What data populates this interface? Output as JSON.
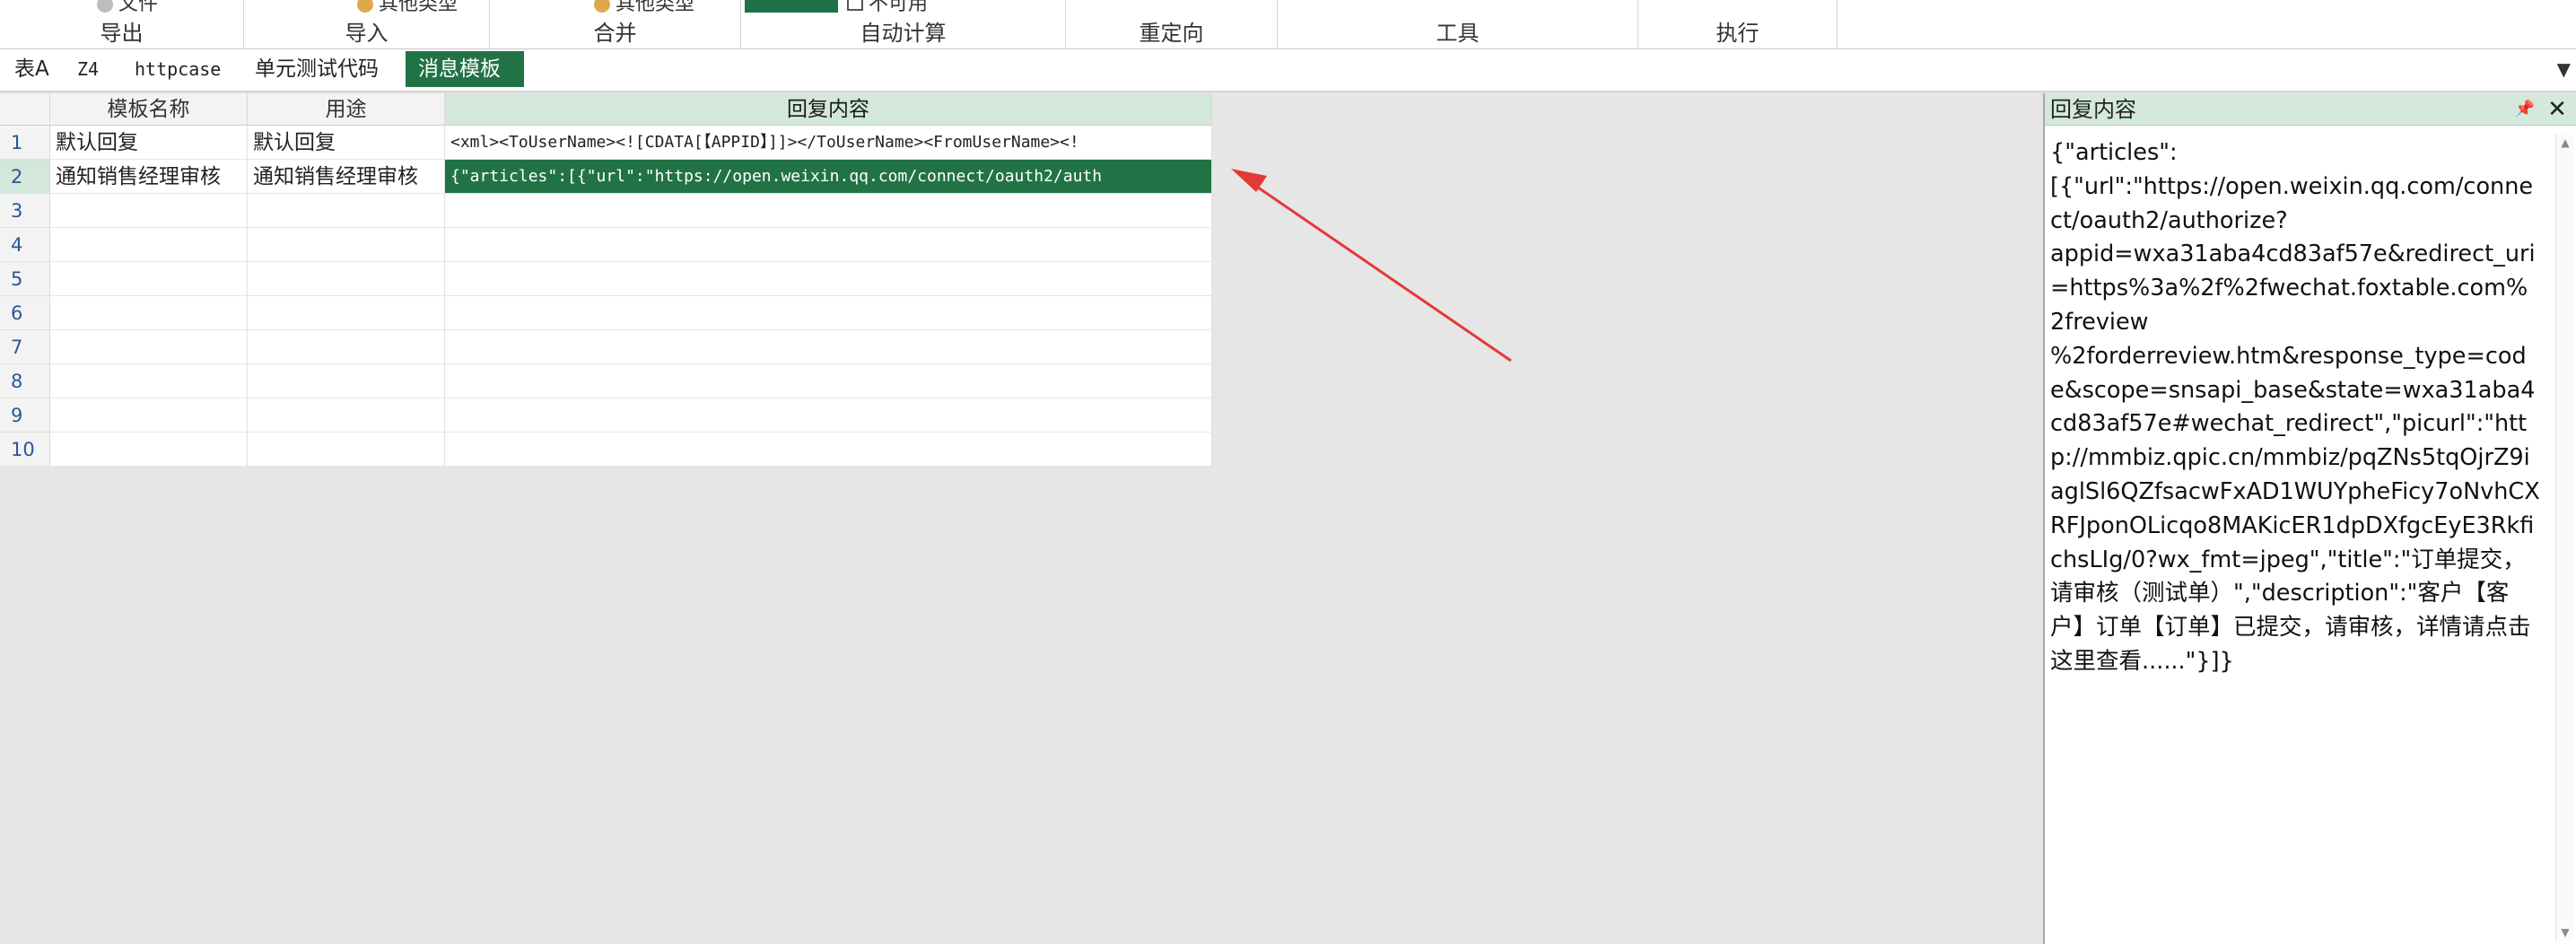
{
  "ribbon": {
    "peek": {
      "export_btn": "文件",
      "import_btn": "其他类型",
      "merge_btn": "其他类型",
      "calc_btn": "不可用"
    },
    "groups": [
      {
        "label": "导出"
      },
      {
        "label": "导入"
      },
      {
        "label": "合并"
      },
      {
        "label": "自动计算"
      },
      {
        "label": "重定向"
      },
      {
        "label": "工具"
      },
      {
        "label": "执行"
      }
    ]
  },
  "tabs": [
    {
      "label": "表A"
    },
    {
      "label": "Z4"
    },
    {
      "label": "httpcase"
    },
    {
      "label": "单元测试代码"
    },
    {
      "label": "消息模板"
    }
  ],
  "tabs_dropdown_icon": "chevron-down-icon",
  "grid": {
    "columns": [
      "模板名称",
      "用途",
      "回复内容"
    ],
    "row_numbers": [
      "1",
      "2",
      "3",
      "4",
      "5",
      "6",
      "7",
      "8",
      "9",
      "10"
    ],
    "rows": [
      [
        "默认回复",
        "默认回复",
        "<xml><ToUserName><![CDATA[【APPID】]]></ToUserName><FromUserName><!"
      ],
      [
        "通知销售经理审核",
        "通知销售经理审核",
        "{\"articles\":[{\"url\":\"https://open.weixin.qq.com/connect/oauth2/auth"
      ]
    ],
    "selected_row": 2,
    "selected_column": 3
  },
  "panel": {
    "title": "回复内容",
    "pin_icon": "📌",
    "close_icon": "✕",
    "content": "{\"articles\":\n[{\"url\":\"https://open.weixin.qq.com/connect/oauth2/authorize?\nappid=wxa31aba4cd83af57e&redirect_uri=https%3a%2f%2fwechat.foxtable.com%2freview\n%2forderreview.htm&response_type=code&scope=snsapi_base&state=wxa31aba4cd83af57e#wechat_redirect\",\"picurl\":\"http://mmbiz.qpic.cn/mmbiz/pqZNs5tqOjrZ9iaglSl6QZfsacwFxAD1WUYpheFicy7oNvhCXRFJponOLicqo8MAKicER1dpDXfgcEyE3RkfichsLIg/0?wx_fmt=jpeg\",\"title\":\"订单提交，请审核（测试单）\",\"description\":\"客户【客户】订单【订单】已提交，请审核，详情请点击这里查看......\"}]}"
  },
  "colors": {
    "accent": "#217346",
    "arrow": "#e53935",
    "header_selected": "#d3e7da"
  }
}
